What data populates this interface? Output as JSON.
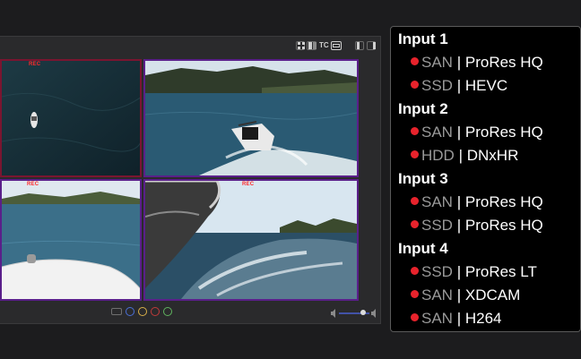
{
  "viewer": {
    "toolbar_icons": [
      "grid-icon",
      "split-icon",
      "tc-label",
      "display-icon",
      "layout-left-icon",
      "layout-right-icon"
    ],
    "tc_label": "TC",
    "cameras": [
      {
        "rec": "REC"
      },
      {
        "rec": ""
      },
      {
        "rec": "REC"
      },
      {
        "rec": "REC"
      }
    ],
    "transport_icons": [
      "loop-icon",
      "record-icon",
      "pause-icon",
      "stop-icon",
      "play-icon"
    ],
    "volume_level": 0.8
  },
  "inputs": [
    {
      "title": "Input 1",
      "streams": [
        {
          "storage": "SAN",
          "format": "ProRes HQ"
        },
        {
          "storage": "SSD",
          "format": "HEVC"
        }
      ]
    },
    {
      "title": "Input 2",
      "streams": [
        {
          "storage": "SAN",
          "format": "ProRes HQ"
        },
        {
          "storage": "HDD",
          "format": "DNxHR"
        }
      ]
    },
    {
      "title": "Input 3",
      "streams": [
        {
          "storage": "SAN",
          "format": "ProRes HQ"
        },
        {
          "storage": "SSD",
          "format": "ProRes HQ"
        }
      ]
    },
    {
      "title": "Input 4",
      "streams": [
        {
          "storage": "SSD",
          "format": "ProRes LT"
        },
        {
          "storage": "SAN",
          "format": "XDCAM"
        },
        {
          "storage": "SAN",
          "format": "H264"
        }
      ]
    }
  ],
  "separator": "|",
  "colors": {
    "record_dot": "#e8232c",
    "storage_text": "#9a9a9a",
    "camera_border": "#5a1f8a"
  }
}
